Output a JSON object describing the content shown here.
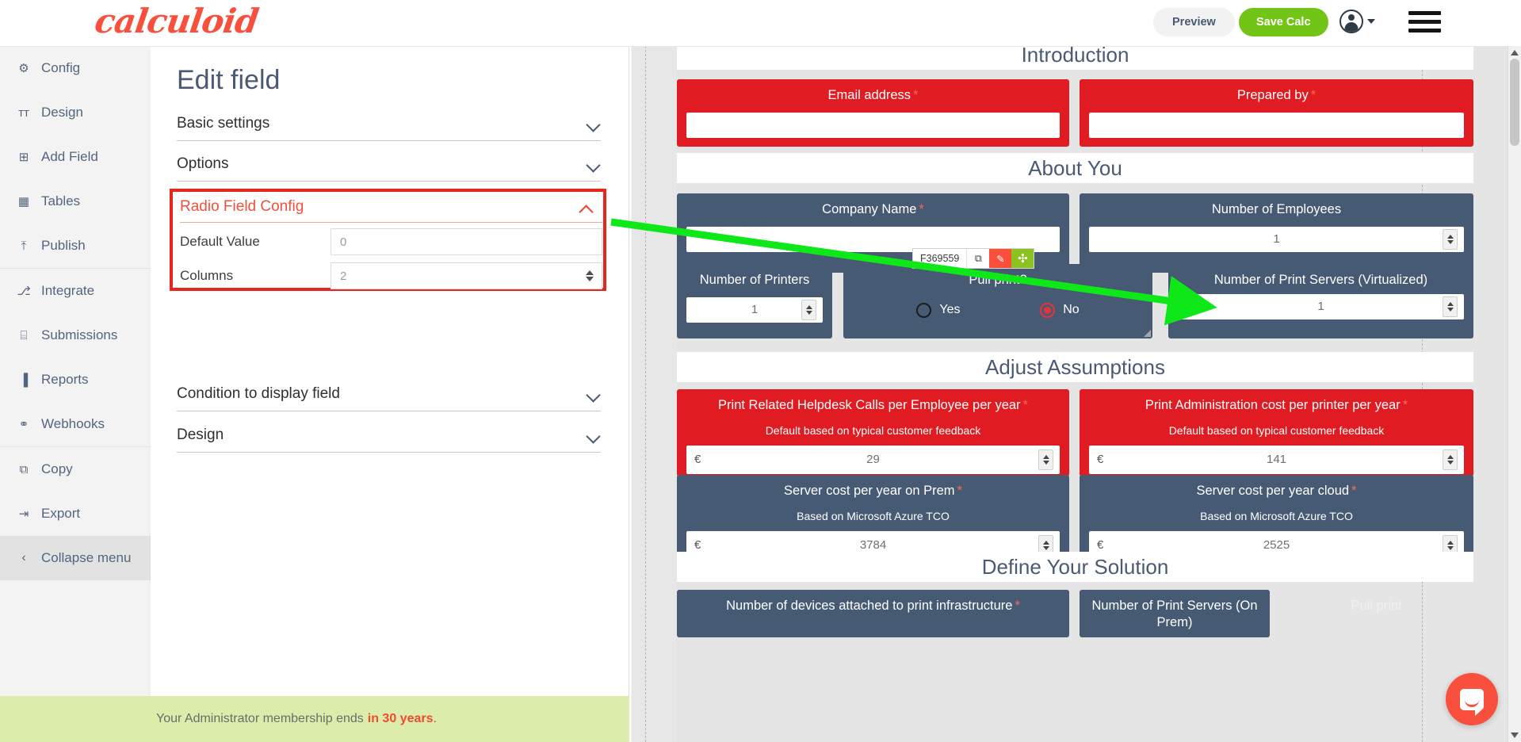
{
  "brand": {
    "name": "calculoid",
    "accent": "#f8503c",
    "green": "#72c516",
    "dark": "#475a74",
    "red": "#e01b22"
  },
  "topbar": {
    "preview_label": "Preview",
    "save_label": "Save Calc",
    "avatar_icon": "user-avatar-icon",
    "caret_icon": "chevron-down-icon",
    "menu_icon": "hamburger-menu-icon"
  },
  "sidebar": {
    "items": [
      {
        "label": "Config",
        "icon": "gear-icon",
        "glyph": "⚙"
      },
      {
        "label": "Design",
        "icon": "text-format-icon",
        "glyph": "ᴛᴛ"
      },
      {
        "label": "Add Field",
        "icon": "plus-square-icon",
        "glyph": "⊞"
      },
      {
        "label": "Tables",
        "icon": "table-icon",
        "glyph": "▦"
      },
      {
        "label": "Publish",
        "icon": "upload-icon",
        "glyph": "⤒"
      },
      {
        "label": "Integrate",
        "icon": "sitemap-icon",
        "glyph": "⎇"
      },
      {
        "label": "Submissions",
        "icon": "inbox-icon",
        "glyph": "⌸"
      },
      {
        "label": "Reports",
        "icon": "bar-chart-icon",
        "glyph": "▐"
      },
      {
        "label": "Webhooks",
        "icon": "share-nodes-icon",
        "glyph": "⚭"
      },
      {
        "label": "Copy",
        "icon": "copy-icon",
        "glyph": "⧉"
      },
      {
        "label": "Export",
        "icon": "export-icon",
        "glyph": "⇥"
      }
    ],
    "collapse": {
      "label": "Collapse menu",
      "icon": "chevron-left-icon",
      "glyph": "‹"
    }
  },
  "edit_panel": {
    "title": "Edit field",
    "sections": [
      {
        "label": "Basic settings",
        "expanded": false
      },
      {
        "label": "Options",
        "expanded": false
      },
      {
        "label": "Condition to display field",
        "expanded": false
      },
      {
        "label": "Design",
        "expanded": false
      }
    ],
    "radio_field_config": {
      "title": "Radio Field Config",
      "expanded": true,
      "highlight_color": "#e8261c",
      "rows": [
        {
          "label": "Default Value",
          "value": "0",
          "has_spinner": false
        },
        {
          "label": "Columns",
          "value": "2",
          "has_spinner": true
        }
      ]
    }
  },
  "membership_bar": {
    "text_prefix": "Your Administrator membership ends",
    "highlight": "in 30 years",
    "suffix": "."
  },
  "field_toolbar": {
    "field_id": "F369559",
    "copy_icon": "duplicate-icon",
    "edit_icon": "pencil-icon",
    "move_icon": "move-arrows-icon"
  },
  "canvas": {
    "sections": [
      {
        "title": "Introduction"
      },
      {
        "title": "About You"
      },
      {
        "title": "Adjust Assumptions"
      },
      {
        "title": "Define Your Solution"
      }
    ],
    "fields": [
      {
        "name": "email-address",
        "label": "Email address",
        "required": true,
        "style": "red",
        "input": "text",
        "value": ""
      },
      {
        "name": "prepared-by",
        "label": "Prepared by",
        "required": true,
        "style": "red",
        "input": "text",
        "value": ""
      },
      {
        "name": "company-name",
        "label": "Company Name",
        "required": true,
        "style": "blue",
        "input": "text",
        "value": ""
      },
      {
        "name": "number-of-employees",
        "label": "Number of Employees",
        "required": false,
        "style": "blue",
        "input": "number",
        "value": "1"
      },
      {
        "name": "number-of-printers",
        "label": "Number of Printers",
        "required": false,
        "style": "blue",
        "input": "number",
        "value": "1"
      },
      {
        "name": "pull-print",
        "label": "Pull print?",
        "required": false,
        "style": "blue",
        "input": "radio",
        "options": [
          {
            "label": "Yes",
            "selected": false
          },
          {
            "label": "No",
            "selected": true
          }
        ]
      },
      {
        "name": "number-of-print-servers-virtualized",
        "label": "Number of Print Servers (Virtualized)",
        "required": false,
        "style": "blue",
        "input": "number",
        "value": "1"
      },
      {
        "name": "print-related-helpdesk-calls",
        "label": "Print Related Helpdesk Calls per Employee per year",
        "sub": "Default based on typical customer feedback",
        "required": true,
        "style": "red",
        "input": "currency",
        "currency": "€",
        "value": "29"
      },
      {
        "name": "print-administration-cost",
        "label": "Print Administration cost per printer per year",
        "sub": "Default based on typical customer feedback",
        "required": true,
        "style": "red",
        "input": "currency",
        "currency": "€",
        "value": "141"
      },
      {
        "name": "server-cost-on-prem",
        "label": "Server cost per year on Prem",
        "sub": "Based on Microsoft Azure TCO",
        "required": true,
        "style": "blue",
        "input": "currency",
        "currency": "€",
        "value": "3784"
      },
      {
        "name": "server-cost-cloud",
        "label": "Server cost per year cloud",
        "sub": "Based on Microsoft Azure TCO",
        "required": true,
        "style": "blue",
        "input": "currency",
        "currency": "€",
        "value": "2525"
      },
      {
        "name": "devices-attached",
        "label": "Number of devices attached to print infrastructure",
        "required": true,
        "style": "blue",
        "input": "text",
        "value": ""
      },
      {
        "name": "print-servers-on-prem",
        "label": "Number of Print Servers (On Prem)",
        "required": false,
        "style": "blue",
        "input": "text",
        "value": ""
      },
      {
        "name": "pull-print-2",
        "label": "Pull print",
        "required": false,
        "style": "ghost",
        "input": "text",
        "value": ""
      }
    ]
  },
  "intercom": {
    "icon": "chat-bubble-icon"
  },
  "scrollbar": {
    "up_icon": "scroll-up-arrow",
    "down_icon": "scroll-down-arrow"
  }
}
